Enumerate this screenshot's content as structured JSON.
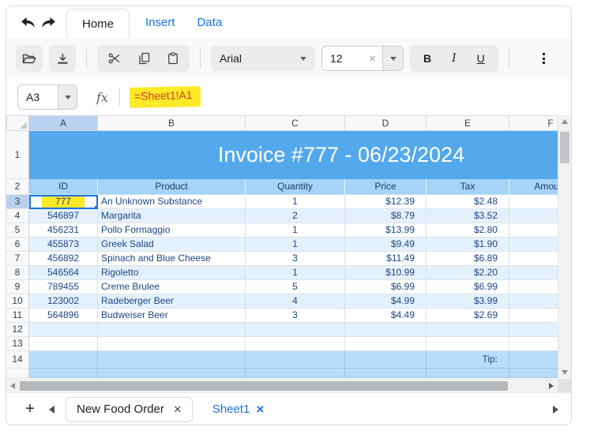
{
  "ribbon": {
    "tabs": [
      {
        "label": "Home",
        "active": true
      },
      {
        "label": "Insert",
        "active": false
      },
      {
        "label": "Data",
        "active": false
      }
    ]
  },
  "toolbar": {
    "font_family": "Arial",
    "font_size": "12",
    "bold_label": "B",
    "italic_label": "I",
    "underline_label": "U"
  },
  "formula_bar": {
    "cell_ref": "A3",
    "fx_label": "fx",
    "formula": "=Sheet1!A1"
  },
  "icons": {
    "plus": "+",
    "close": "×",
    "clear": "×"
  },
  "grid": {
    "column_letters": [
      "A",
      "B",
      "C",
      "D",
      "E",
      "F"
    ],
    "title_row_num": "1",
    "header_row_num": "2",
    "title": "Invoice #777 - 06/23/2024",
    "headers": [
      "ID",
      "Product",
      "Quantity",
      "Price",
      "Tax",
      "Amount"
    ],
    "selected_cell": {
      "ref": "A3",
      "value": "777"
    },
    "body_rows": [
      {
        "n": "3",
        "style": "white",
        "selected": true,
        "cells": [
          "777",
          "An Unknown Substance",
          "1",
          "$12.39",
          "$2.48",
          ""
        ]
      },
      {
        "n": "4",
        "style": "band",
        "cells": [
          "546897",
          "Margarita",
          "2",
          "$8.79",
          "$3.52",
          ""
        ]
      },
      {
        "n": "5",
        "style": "white",
        "cells": [
          "456231",
          "Pollo Formaggio",
          "1",
          "$13.99",
          "$2.80",
          ""
        ]
      },
      {
        "n": "6",
        "style": "band",
        "cells": [
          "455873",
          "Greek Salad",
          "1",
          "$9.49",
          "$1.90",
          ""
        ]
      },
      {
        "n": "7",
        "style": "white",
        "cells": [
          "456892",
          "Spinach and Blue Cheese",
          "3",
          "$11.49",
          "$6.89",
          ""
        ]
      },
      {
        "n": "8",
        "style": "band",
        "cells": [
          "546564",
          "Rigoletto",
          "1",
          "$10.99",
          "$2.20",
          ""
        ]
      },
      {
        "n": "9",
        "style": "white",
        "cells": [
          "789455",
          "Creme Brulee",
          "5",
          "$6.99",
          "$6.99",
          ""
        ]
      },
      {
        "n": "10",
        "style": "band",
        "cells": [
          "123002",
          "Radeberger Beer",
          "4",
          "$4.99",
          "$3.99",
          ""
        ]
      },
      {
        "n": "11",
        "style": "white",
        "cells": [
          "564896",
          "Budweiser Beer",
          "3",
          "$4.49",
          "$2.69",
          ""
        ]
      },
      {
        "n": "12",
        "style": "band",
        "cells": [
          "",
          "",
          "",
          "",
          "",
          ""
        ]
      },
      {
        "n": "13",
        "style": "white",
        "cells": [
          "",
          "",
          "",
          "",
          "",
          ""
        ]
      },
      {
        "n": "14",
        "style": "blue",
        "height": 22,
        "cells": [
          "",
          "",
          "",
          "",
          "Tip:",
          ""
        ]
      },
      {
        "n": "",
        "style": "blue",
        "height": 12,
        "partial": true,
        "cells": [
          "",
          "",
          "",
          "",
          "",
          ""
        ]
      }
    ]
  },
  "sheet_bar": {
    "tabs": [
      {
        "label": "New Food Order",
        "active": true
      },
      {
        "label": "Sheet1",
        "active": false
      }
    ]
  },
  "colors": {
    "title_bg": "#54a8ec",
    "header_bg": "#a6d4f8",
    "band_bg": "#e4f1fd",
    "tip_row_bg": "#b9dcfa",
    "selection": "#1a73e8",
    "link": "#1a73e8",
    "formula_text": "#d23f31",
    "highlight": "#fce928",
    "cell_text": "#1c4587"
  }
}
